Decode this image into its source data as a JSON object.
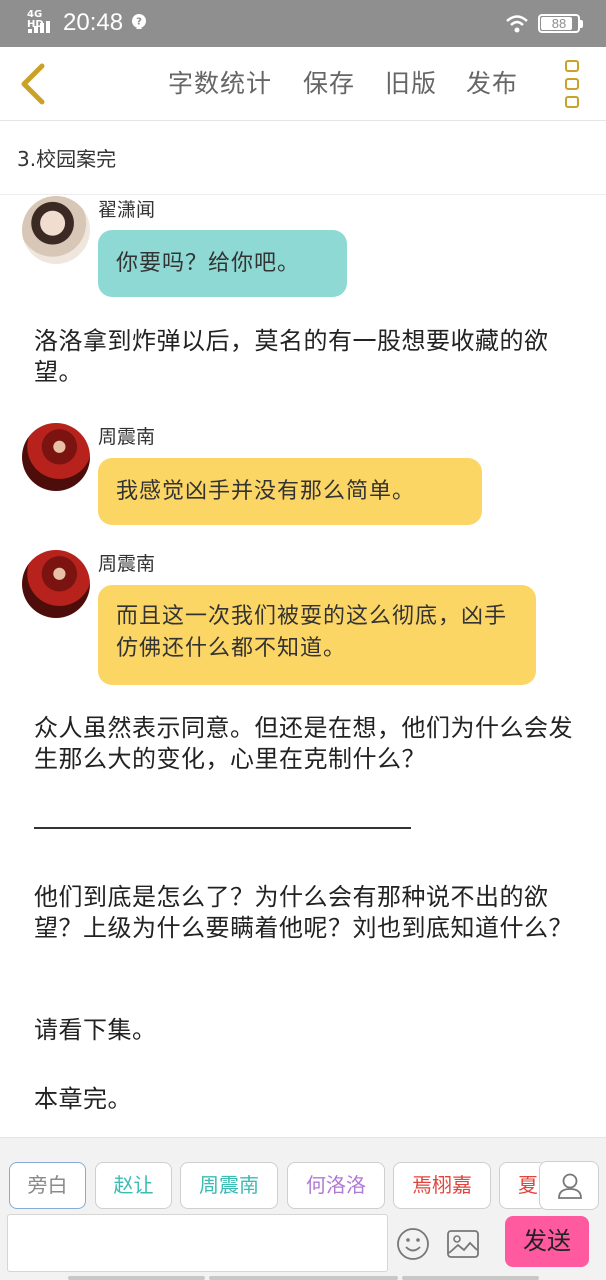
{
  "status_bar": {
    "network": "4G HD",
    "time": "20:48",
    "battery": "88",
    "battery_level": 0.88
  },
  "toolbar": {
    "back_icon": "chevron-left-icon",
    "word_count": "字数统计",
    "save": "保存",
    "old_version": "旧版",
    "publish": "发布",
    "menu_icon": "more-vertical-icon",
    "accent_color": "#c9a227"
  },
  "chapter": {
    "title": "3.校园案完"
  },
  "content": {
    "msg1": {
      "sender": "翟潇闻",
      "text": "你要吗？给你吧。"
    },
    "narr1": "洛洛拿到炸弹以后，莫名的有一股想要收藏的欲望。",
    "msg2": {
      "sender": "周震南",
      "text": "我感觉凶手并没有那么简单。"
    },
    "msg3": {
      "sender": "周震南",
      "text": "而且这一次我们被耍的这么彻底，凶手仿佛还什么都不知道。"
    },
    "narr2": "众人虽然表示同意。但还是在想，他们为什么会发生那么大的变化，心里在克制什么？",
    "narr3": "他们到底是怎么了？为什么会有那种说不出的欲望？上级为什么要瞒着他呢？刘也到底知道什么？",
    "narr4": "请看下集。",
    "narr5": "本章完。"
  },
  "roles": [
    {
      "label": "旁白",
      "color": "#8a8a8a"
    },
    {
      "label": "赵让",
      "color": "#3bbcb3"
    },
    {
      "label": "周震南",
      "color": "#3bbcb3"
    },
    {
      "label": "何洛洛",
      "color": "#b07ad6"
    },
    {
      "label": "焉栩嘉",
      "color": "#e0453d"
    },
    {
      "label": "夏",
      "color": "#e0453d"
    }
  ],
  "composer": {
    "input_value": "",
    "send": "发送",
    "send_color": "#ff5aa0"
  }
}
